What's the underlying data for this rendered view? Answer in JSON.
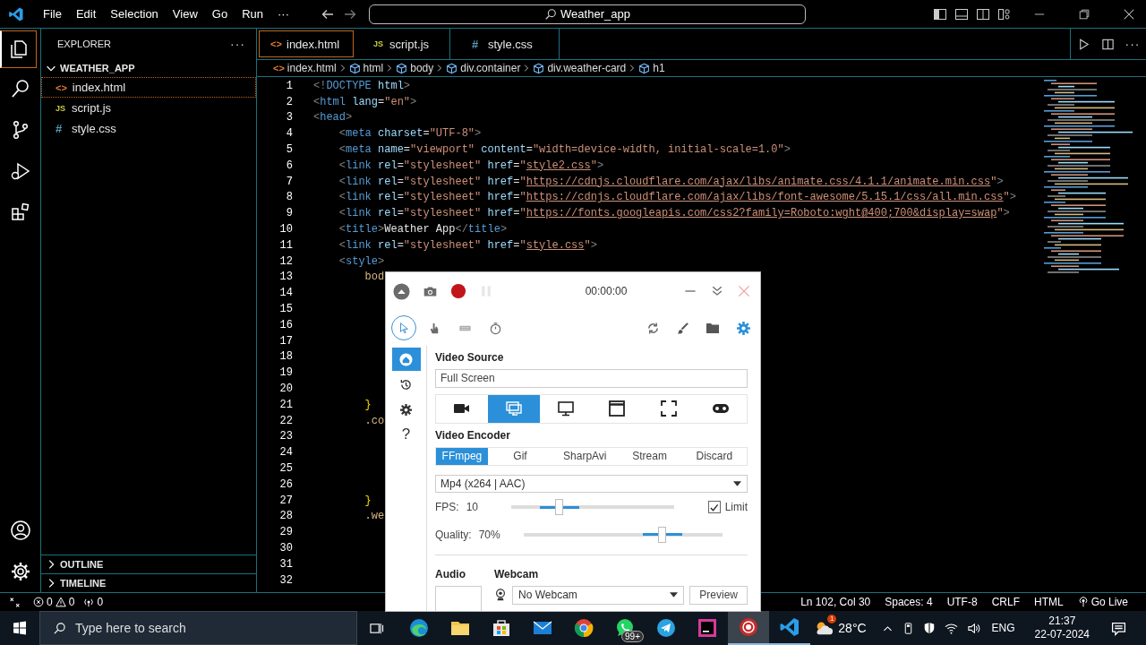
{
  "titlebar": {
    "menu": [
      "File",
      "Edit",
      "Selection",
      "View",
      "Go",
      "Run",
      "···"
    ],
    "command_center": "Weather_app"
  },
  "activity_bar": [
    {
      "kind": "explorer",
      "selected": true
    },
    {
      "kind": "search",
      "selected": false
    },
    {
      "kind": "source_control",
      "selected": false
    },
    {
      "kind": "run",
      "selected": false
    },
    {
      "kind": "extensions",
      "selected": false
    }
  ],
  "activity_bottom": [
    {
      "kind": "account"
    },
    {
      "kind": "manage"
    }
  ],
  "sidebar": {
    "title": "EXPLORER",
    "more": "···",
    "folder": {
      "name": "WEATHER_APP",
      "expanded": true,
      "files": [
        {
          "name": "index.html",
          "kind": "html",
          "icon": "<>",
          "selected": true
        },
        {
          "name": "script.js",
          "kind": "js",
          "icon": "JS",
          "selected": false
        },
        {
          "name": "style.css",
          "kind": "css",
          "icon": "#",
          "selected": false
        }
      ]
    },
    "sections": [
      {
        "name": "OUTLINE",
        "expanded": false
      },
      {
        "name": "TIMELINE",
        "expanded": false
      }
    ]
  },
  "tabs": [
    {
      "name": "index.html",
      "kind": "html",
      "icon": "<>",
      "selected": true
    },
    {
      "name": "script.js",
      "kind": "js",
      "icon": "JS",
      "selected": false
    },
    {
      "name": "style.css",
      "kind": "css",
      "icon": "#",
      "selected": false
    }
  ],
  "editor_more": "···",
  "breadcrumb": [
    {
      "label": "index.html",
      "kind": "html",
      "icon": "<>"
    },
    {
      "label": "html",
      "kind": "element"
    },
    {
      "label": "body",
      "kind": "element"
    },
    {
      "label": "div.container",
      "kind": "element"
    },
    {
      "label": "div.weather-card",
      "kind": "element"
    },
    {
      "label": "h1",
      "kind": "element"
    }
  ],
  "code": [
    {
      "n": "1",
      "tokens": [
        {
          "kind": "p",
          "s": "<!"
        },
        {
          "kind": "tag",
          "s": "DOCTYPE"
        },
        {
          "kind": "attr",
          "s": " html"
        },
        {
          "kind": "p",
          "s": ">"
        }
      ]
    },
    {
      "n": "2",
      "tokens": [
        {
          "kind": "p",
          "s": "<"
        },
        {
          "kind": "tag",
          "s": "html"
        },
        {
          "kind": "attr",
          "s": " lang"
        },
        {
          "kind": "txt",
          "s": "="
        },
        {
          "kind": "str",
          "s": "\"en\""
        },
        {
          "kind": "p",
          "s": ">"
        }
      ]
    },
    {
      "n": "3",
      "tokens": [
        {
          "kind": "p",
          "s": "<"
        },
        {
          "kind": "tag",
          "s": "head"
        },
        {
          "kind": "p",
          "s": ">"
        }
      ]
    },
    {
      "n": "4",
      "tokens": [
        {
          "kind": "p",
          "s": "    <"
        },
        {
          "kind": "tag",
          "s": "meta"
        },
        {
          "kind": "attr",
          "s": " charset"
        },
        {
          "kind": "txt",
          "s": "="
        },
        {
          "kind": "str",
          "s": "\"UTF-8\""
        },
        {
          "kind": "p",
          "s": ">"
        }
      ]
    },
    {
      "n": "5",
      "tokens": [
        {
          "kind": "p",
          "s": "    <"
        },
        {
          "kind": "tag",
          "s": "meta"
        },
        {
          "kind": "attr",
          "s": " name"
        },
        {
          "kind": "txt",
          "s": "="
        },
        {
          "kind": "str",
          "s": "\"viewport\""
        },
        {
          "kind": "attr",
          "s": " content"
        },
        {
          "kind": "txt",
          "s": "="
        },
        {
          "kind": "str",
          "s": "\"width=device-width, initial-scale=1.0\""
        },
        {
          "kind": "p",
          "s": ">"
        }
      ]
    },
    {
      "n": "6",
      "tokens": [
        {
          "kind": "p",
          "s": "    <"
        },
        {
          "kind": "tag",
          "s": "link"
        },
        {
          "kind": "attr",
          "s": " rel"
        },
        {
          "kind": "txt",
          "s": "="
        },
        {
          "kind": "str",
          "s": "\"stylesheet\""
        },
        {
          "kind": "attr",
          "s": " href"
        },
        {
          "kind": "txt",
          "s": "="
        },
        {
          "kind": "str",
          "s": "\""
        },
        {
          "kind": "link",
          "s": "style2.css"
        },
        {
          "kind": "str",
          "s": "\""
        },
        {
          "kind": "p",
          "s": ">"
        }
      ]
    },
    {
      "n": "7",
      "tokens": [
        {
          "kind": "p",
          "s": "    <"
        },
        {
          "kind": "tag",
          "s": "link"
        },
        {
          "kind": "attr",
          "s": " rel"
        },
        {
          "kind": "txt",
          "s": "="
        },
        {
          "kind": "str",
          "s": "\"stylesheet\""
        },
        {
          "kind": "attr",
          "s": " href"
        },
        {
          "kind": "txt",
          "s": "="
        },
        {
          "kind": "str",
          "s": "\""
        },
        {
          "kind": "link",
          "s": "https://cdnjs.cloudflare.com/ajax/libs/animate.css/4.1.1/animate.min.css"
        },
        {
          "kind": "str",
          "s": "\""
        },
        {
          "kind": "p",
          "s": ">"
        }
      ]
    },
    {
      "n": "8",
      "tokens": [
        {
          "kind": "p",
          "s": "    <"
        },
        {
          "kind": "tag",
          "s": "link"
        },
        {
          "kind": "attr",
          "s": " rel"
        },
        {
          "kind": "txt",
          "s": "="
        },
        {
          "kind": "str",
          "s": "\"stylesheet\""
        },
        {
          "kind": "attr",
          "s": " href"
        },
        {
          "kind": "txt",
          "s": "="
        },
        {
          "kind": "str",
          "s": "\""
        },
        {
          "kind": "link",
          "s": "https://cdnjs.cloudflare.com/ajax/libs/font-awesome/5.15.1/css/all.min.css"
        },
        {
          "kind": "str",
          "s": "\""
        },
        {
          "kind": "p",
          "s": ">"
        }
      ]
    },
    {
      "n": "9",
      "tokens": [
        {
          "kind": "p",
          "s": "    <"
        },
        {
          "kind": "tag",
          "s": "link"
        },
        {
          "kind": "attr",
          "s": " rel"
        },
        {
          "kind": "txt",
          "s": "="
        },
        {
          "kind": "str",
          "s": "\"stylesheet\""
        },
        {
          "kind": "attr",
          "s": " href"
        },
        {
          "kind": "txt",
          "s": "="
        },
        {
          "kind": "str",
          "s": "\""
        },
        {
          "kind": "link",
          "s": "https://fonts.googleapis.com/css2?family=Roboto:wght@400;700&display=swap"
        },
        {
          "kind": "str",
          "s": "\""
        },
        {
          "kind": "p",
          "s": ">"
        }
      ]
    },
    {
      "n": "10",
      "tokens": [
        {
          "kind": "p",
          "s": "    <"
        },
        {
          "kind": "tag",
          "s": "title"
        },
        {
          "kind": "p",
          "s": ">"
        },
        {
          "kind": "txt",
          "s": "Weather App"
        },
        {
          "kind": "p",
          "s": "</"
        },
        {
          "kind": "tag",
          "s": "title"
        },
        {
          "kind": "p",
          "s": ">"
        }
      ]
    },
    {
      "n": "11",
      "tokens": [
        {
          "kind": "p",
          "s": "    <"
        },
        {
          "kind": "tag",
          "s": "link"
        },
        {
          "kind": "attr",
          "s": " rel"
        },
        {
          "kind": "txt",
          "s": "="
        },
        {
          "kind": "str",
          "s": "\"stylesheet\""
        },
        {
          "kind": "attr",
          "s": " href"
        },
        {
          "kind": "txt",
          "s": "="
        },
        {
          "kind": "str",
          "s": "\""
        },
        {
          "kind": "link",
          "s": "style.css"
        },
        {
          "kind": "str",
          "s": "\""
        },
        {
          "kind": "p",
          "s": ">"
        }
      ]
    },
    {
      "n": "12",
      "tokens": [
        {
          "kind": "p",
          "s": "    <"
        },
        {
          "kind": "tag",
          "s": "style"
        },
        {
          "kind": "p",
          "s": ">"
        }
      ]
    },
    {
      "n": "13",
      "tokens": [
        {
          "kind": "sel",
          "s": "        bod"
        }
      ]
    },
    {
      "n": "14"
    },
    {
      "n": "15"
    },
    {
      "n": "16"
    },
    {
      "n": "17"
    },
    {
      "n": "18"
    },
    {
      "n": "19"
    },
    {
      "n": "20"
    },
    {
      "n": "21",
      "tokens": [
        {
          "kind": "brace",
          "s": "        }"
        }
      ]
    },
    {
      "n": "22",
      "tokens": [
        {
          "kind": "sel",
          "s": "        .co"
        }
      ]
    },
    {
      "n": "23"
    },
    {
      "n": "24"
    },
    {
      "n": "25"
    },
    {
      "n": "26"
    },
    {
      "n": "27",
      "tokens": [
        {
          "kind": "brace",
          "s": "        }"
        }
      ]
    },
    {
      "n": "28",
      "tokens": [
        {
          "kind": "sel",
          "s": "        .we"
        }
      ]
    },
    {
      "n": "29"
    },
    {
      "n": "30"
    },
    {
      "n": "31"
    },
    {
      "n": "32"
    }
  ],
  "status_bar": {
    "errors": "0",
    "warnings": "0",
    "ports": "0",
    "items": [
      "Ln 102, Col 30",
      "Spaces: 4",
      "UTF-8",
      "CRLF",
      "HTML"
    ],
    "go_live": "Go Live"
  },
  "recorder": {
    "timer": "00:00:00",
    "tools": [
      {
        "kind": "cursor",
        "selected": true
      },
      {
        "kind": "hand",
        "selected": false
      },
      {
        "kind": "keyboard",
        "selected": false
      },
      {
        "kind": "timer",
        "selected": false
      }
    ],
    "nav": [
      {
        "kind": "home",
        "selected": true
      },
      {
        "kind": "history",
        "selected": false
      },
      {
        "kind": "settings",
        "selected": false
      },
      {
        "kind": "help",
        "label": "?",
        "selected": false
      }
    ],
    "video_source": {
      "label": "Video Source",
      "value": "Full Screen",
      "sources": [
        {
          "kind": "webcam",
          "selected": false
        },
        {
          "kind": "screens",
          "selected": true
        },
        {
          "kind": "screen",
          "selected": false
        },
        {
          "kind": "window",
          "selected": false
        },
        {
          "kind": "region",
          "selected": false
        },
        {
          "kind": "gamepad",
          "selected": false
        }
      ]
    },
    "video_encoder": {
      "label": "Video Encoder",
      "tabs": [
        {
          "label": "FFmpeg",
          "selected": true
        },
        {
          "label": "Gif",
          "selected": false
        },
        {
          "label": "SharpAvi",
          "selected": false
        },
        {
          "label": "Stream",
          "selected": false
        },
        {
          "label": "Discard",
          "selected": false
        }
      ],
      "format": "Mp4 (x264 | AAC)"
    },
    "fps": {
      "label": "FPS:",
      "value": "10",
      "level": 0.3,
      "limit": {
        "label": "Limit",
        "checked": true
      }
    },
    "quality": {
      "label": "Quality:",
      "value": "70%",
      "level": 0.7
    },
    "audio": {
      "label": "Audio"
    },
    "webcam": {
      "label": "Webcam",
      "value": "No Webcam",
      "button": "Preview"
    }
  },
  "taskbar": {
    "search_placeholder": "Type here to search",
    "apps": [
      {
        "kind": "edge",
        "selected": false,
        "running": false
      },
      {
        "kind": "explorer",
        "selected": false,
        "running": false
      },
      {
        "kind": "store",
        "selected": false,
        "running": false
      },
      {
        "kind": "mail",
        "selected": false,
        "running": false
      },
      {
        "kind": "chrome",
        "selected": false,
        "running": false
      },
      {
        "kind": "whatsapp",
        "selected": false,
        "running": false,
        "badge": "99+"
      },
      {
        "kind": "telegram",
        "selected": false,
        "running": false
      },
      {
        "kind": "jetbrains",
        "selected": false,
        "running": false
      },
      {
        "kind": "recorder",
        "selected": true,
        "running": true
      },
      {
        "kind": "vscode",
        "selected": false,
        "running": true
      }
    ],
    "weather": {
      "temp": "28°C",
      "badge": "1"
    },
    "language": "ENG",
    "time": "21:37",
    "date": "22-07-2024"
  }
}
